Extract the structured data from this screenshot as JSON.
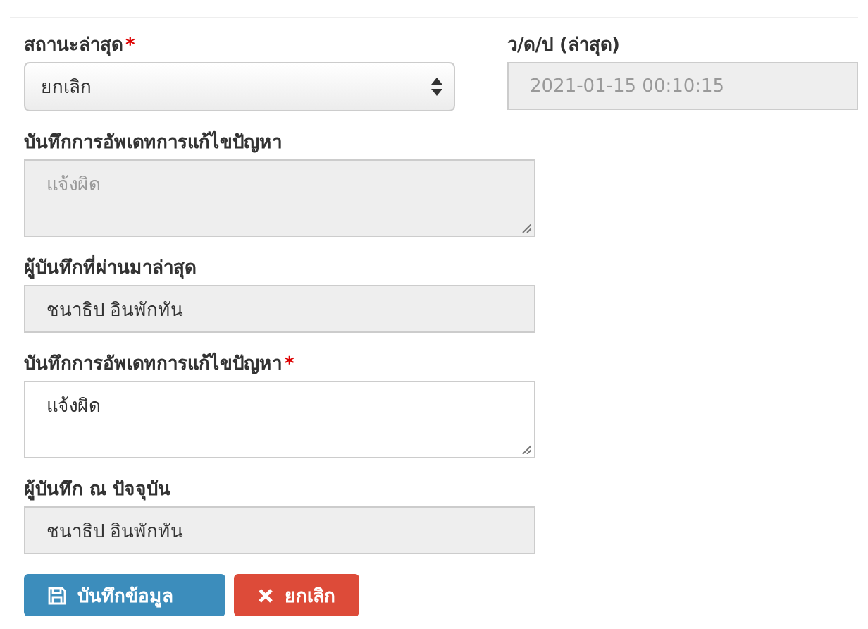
{
  "status_row": [
    {
      "kind": "select",
      "label": "สถานะล่าสุด",
      "required_mark": "*",
      "value": "ยกเลิก",
      "disabled": false
    },
    {
      "kind": "text",
      "label": "ว/ด/ป (ล่าสุด)",
      "value": "2021-01-15 00:10:15",
      "disabled": true
    }
  ],
  "fields": [
    {
      "kind": "textarea",
      "label": "บันทึกการอัพเดทการแก้ไขปัญหา",
      "value": "แจ้งผิด",
      "disabled": true
    },
    {
      "kind": "text",
      "label": "ผู้บันทึกที่ผ่านมาล่าสุด",
      "value": "ชนาธิป อินพักทัน",
      "disabled": true
    },
    {
      "kind": "textarea",
      "label": "บันทึกการอัพเดทการแก้ไขปัญหา",
      "required_mark": "*",
      "value": "แจ้งผิด",
      "disabled": false
    },
    {
      "kind": "text",
      "label": "ผู้บันทึก ณ ปัจจุบัน",
      "value": "ชนาธิป อินพักทัน",
      "disabled": true
    }
  ],
  "buttons": [
    {
      "kind": "save",
      "label": "บันทึกข้อมูล"
    },
    {
      "kind": "cancel",
      "label": "ยกเลิก"
    }
  ]
}
